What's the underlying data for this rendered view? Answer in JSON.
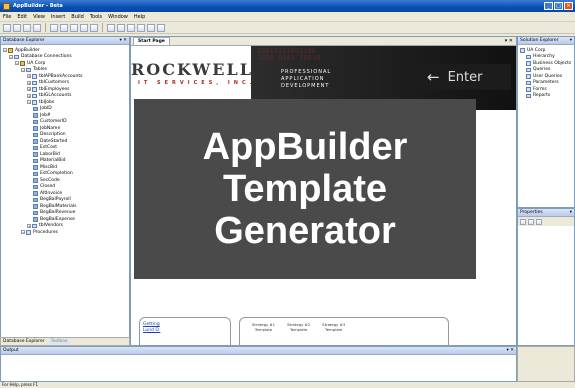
{
  "window": {
    "title": "AppBuilder - Beta"
  },
  "menu": [
    "File",
    "Edit",
    "View",
    "Insert",
    "Build",
    "Tools",
    "Window",
    "Help"
  ],
  "left_panel": {
    "title": "Database Explorer",
    "controls": "▾ ✕",
    "tree": [
      {
        "label": "AppBuilder",
        "level": 0,
        "kind": "db"
      },
      {
        "label": "Database Connections",
        "level": 1,
        "kind": "folder"
      },
      {
        "label": "UA Corp",
        "level": 2,
        "kind": "db"
      },
      {
        "label": "Tables",
        "level": 3,
        "kind": "folder"
      },
      {
        "label": "tblAPBankAccounts",
        "level": 4,
        "kind": "table"
      },
      {
        "label": "tblCustomers",
        "level": 4,
        "kind": "table"
      },
      {
        "label": "tblEmployees",
        "level": 4,
        "kind": "table"
      },
      {
        "label": "tblGLAccounts",
        "level": 4,
        "kind": "table"
      },
      {
        "label": "tblJobs",
        "level": 4,
        "kind": "table"
      },
      {
        "label": "JobID",
        "level": 5,
        "kind": "col"
      },
      {
        "label": "Job#",
        "level": 5,
        "kind": "col"
      },
      {
        "label": "CustomerID",
        "level": 5,
        "kind": "col"
      },
      {
        "label": "JobName",
        "level": 5,
        "kind": "col"
      },
      {
        "label": "Description",
        "level": 5,
        "kind": "col"
      },
      {
        "label": "DateStarted",
        "level": 5,
        "kind": "col"
      },
      {
        "label": "EstCost",
        "level": 5,
        "kind": "col"
      },
      {
        "label": "LaborBid",
        "level": 5,
        "kind": "col"
      },
      {
        "label": "MaterialBid",
        "level": 5,
        "kind": "col"
      },
      {
        "label": "MiscBid",
        "level": 5,
        "kind": "col"
      },
      {
        "label": "EstCompletion",
        "level": 5,
        "kind": "col"
      },
      {
        "label": "SecCode",
        "level": 5,
        "kind": "col"
      },
      {
        "label": "Closed",
        "level": 5,
        "kind": "col"
      },
      {
        "label": "AltInvoice",
        "level": 5,
        "kind": "col"
      },
      {
        "label": "BegBalPayroll",
        "level": 5,
        "kind": "col"
      },
      {
        "label": "BegBalMaterials",
        "level": 5,
        "kind": "col"
      },
      {
        "label": "BegBalRevenue",
        "level": 5,
        "kind": "col"
      },
      {
        "label": "BegBalExpense",
        "level": 5,
        "kind": "col"
      },
      {
        "label": "tblVendors",
        "level": 4,
        "kind": "table"
      },
      {
        "label": "Procedures",
        "level": 3,
        "kind": "folder"
      }
    ],
    "footer_tabs": [
      "Database Explorer",
      "Toolbox"
    ]
  },
  "document": {
    "tab": "Start Page",
    "banner": {
      "logo": "ROCKWELL",
      "logo_sub": "IT SERVICES, INC.",
      "tagline": [
        "PROFESSIONAL",
        "APPLICATION",
        "DEVELOPMENT"
      ],
      "binary": "10011011001100\n1010 0101 10010",
      "enter": "Enter"
    },
    "links": [
      "Getting",
      "Lund D."
    ],
    "templates": [
      [
        "Strategy #1",
        "Template"
      ],
      [
        "Strategy #2",
        "Template"
      ],
      [
        "Strategy #3",
        "Template"
      ]
    ]
  },
  "right_panel": {
    "title": "Solution Explorer",
    "tree": [
      "UA Corp",
      "Hierarchy",
      "Business Objects",
      "Queries",
      "User Queries",
      "Parameters",
      "Forms",
      "Reports"
    ]
  },
  "properties_panel": {
    "title": "Properties"
  },
  "output_panel": {
    "title": "Output"
  },
  "status": "For Help, press F1",
  "overlay": {
    "lines": [
      "AppBuilder",
      "Template",
      "Generator"
    ]
  }
}
